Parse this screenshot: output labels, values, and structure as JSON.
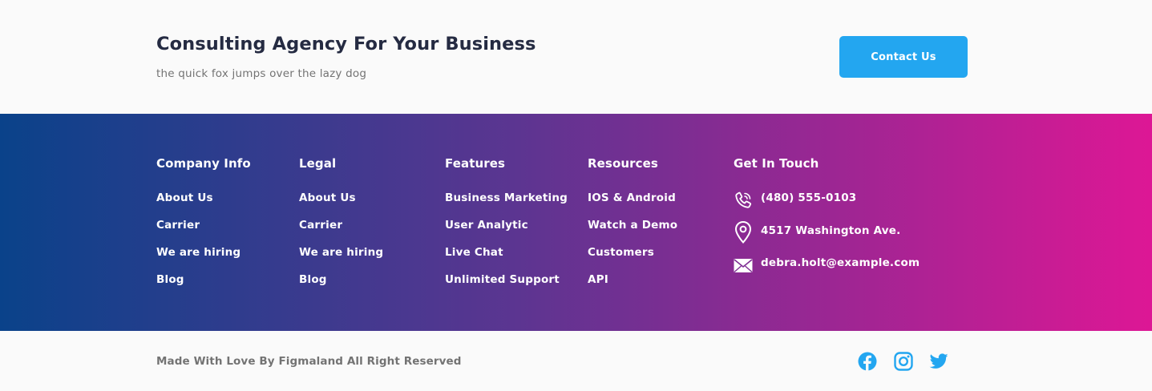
{
  "cta_section": {
    "title": "Consulting Agency For Your Business",
    "subtitle": "the quick fox jumps over the lazy dog",
    "button_label": "Contact Us"
  },
  "footer": {
    "gradient": {
      "from": "#0A428A",
      "via": "#5C3591",
      "to": "#DD1795"
    },
    "columns": [
      {
        "heading": "Company Info",
        "links": [
          "About Us",
          "Carrier",
          "We are hiring",
          "Blog"
        ]
      },
      {
        "heading": "Legal",
        "links": [
          "About Us",
          "Carrier",
          "We are hiring",
          "Blog"
        ]
      },
      {
        "heading": "Features",
        "links": [
          "Business Marketing",
          "User Analytic",
          "Live Chat",
          "Unlimited Support"
        ]
      },
      {
        "heading": "Resources",
        "links": [
          "IOS & Android",
          "Watch a Demo",
          "Customers",
          "API"
        ]
      }
    ],
    "contact": {
      "heading": "Get In Touch",
      "items": [
        {
          "icon": "phone-icon",
          "text": "(480) 555-0103"
        },
        {
          "icon": "location-pin-icon",
          "text": "4517 Washington Ave."
        },
        {
          "icon": "envelope-icon",
          "text": "debra.holt@example.com"
        }
      ]
    }
  },
  "bottom_bar": {
    "copyright": "Made With Love By Figmaland All Right Reserved",
    "social_color": "#23A6F0",
    "social": [
      "facebook-icon",
      "instagram-icon",
      "twitter-icon"
    ]
  }
}
